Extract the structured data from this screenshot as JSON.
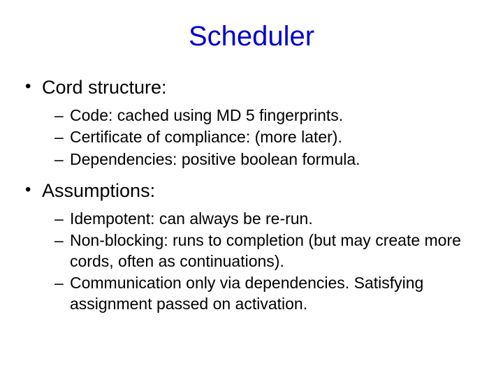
{
  "title": "Scheduler",
  "bullets": [
    {
      "label": "Cord structure:",
      "sub": [
        "Code: cached using MD 5 fingerprints.",
        "Certificate of compliance: (more later).",
        "Dependencies: positive boolean formula."
      ]
    },
    {
      "label": "Assumptions:",
      "sub": [
        "Idempotent: can always be re-run.",
        "Non-blocking: runs to completion (but may create more cords, often as continuations).",
        "Communication only via dependencies.  Satisfying assignment passed on activation."
      ]
    }
  ]
}
